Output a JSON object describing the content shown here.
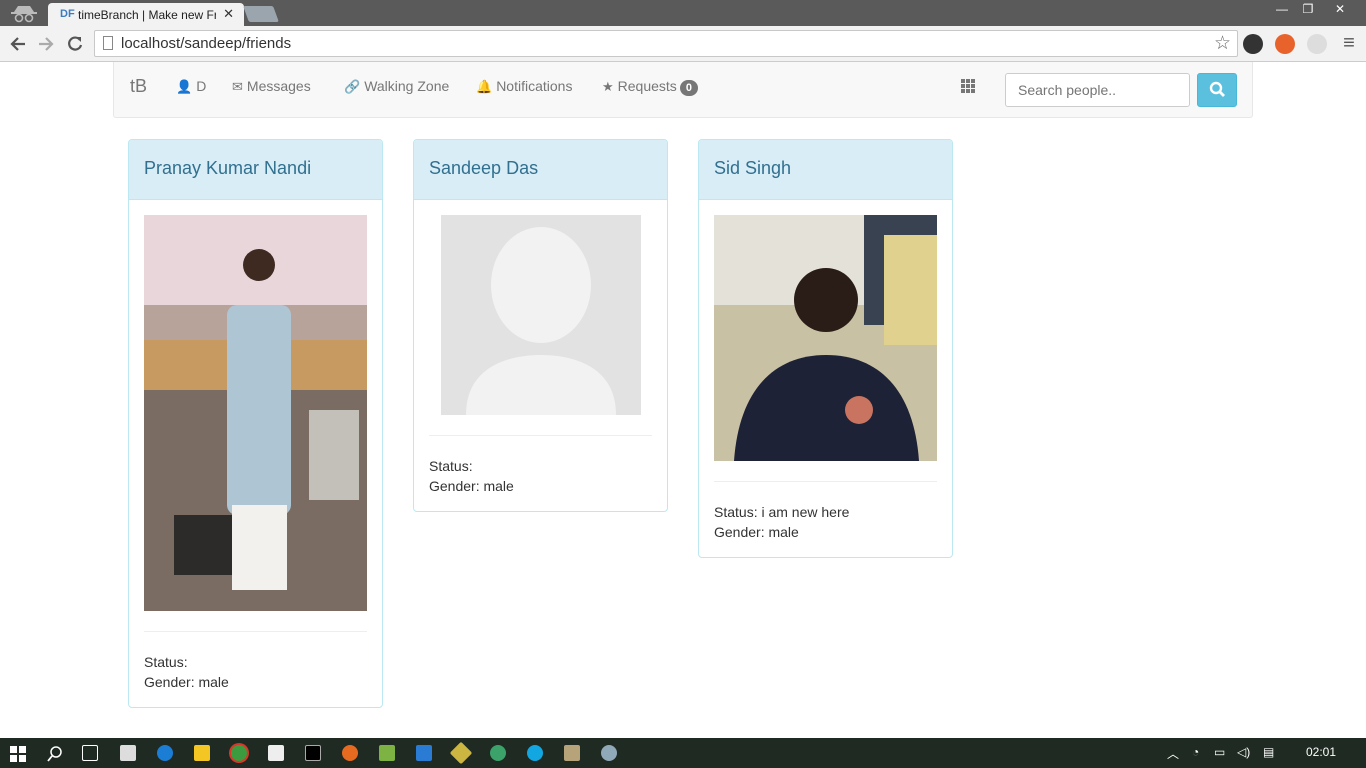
{
  "browser": {
    "tab_title": "timeBranch | Make new Fr",
    "tab_favicon": "DF",
    "url": "localhost/sandeep/friends",
    "close_tab": "✕",
    "minimize": "—",
    "restore": "❐",
    "close": "✕"
  },
  "navbar": {
    "brand": "tB",
    "items": [
      {
        "icon": "user-icon",
        "glyph": "👤",
        "label": "D"
      },
      {
        "icon": "envelope-icon",
        "glyph": "✉",
        "label": "Messages"
      },
      {
        "icon": "link-icon",
        "glyph": "🔗",
        "label": "Walking Zone"
      },
      {
        "icon": "bell-icon",
        "glyph": "🔔",
        "label": "Notifications"
      },
      {
        "icon": "star-icon",
        "glyph": "★",
        "label": "Requests",
        "badge": "0"
      }
    ],
    "search_placeholder": "Search people.."
  },
  "friends": [
    {
      "name": "Pranay Kumar Nandi",
      "status_label": "Status:",
      "gender_label": "Gender: male"
    },
    {
      "name": "Sandeep Das",
      "status_label": "Status:",
      "gender_label": "Gender: male"
    },
    {
      "name": "Sid Singh",
      "status_label": "Status: i am new here",
      "gender_label": "Gender: male"
    }
  ],
  "taskbar": {
    "clock": "02:01"
  },
  "colors": {
    "panel_heading_bg": "#d9edf7",
    "panel_border": "#bce8f1",
    "name_text": "#31708f",
    "search_button": "#5bc0de",
    "taskbar_bg": "#1f2a22"
  }
}
